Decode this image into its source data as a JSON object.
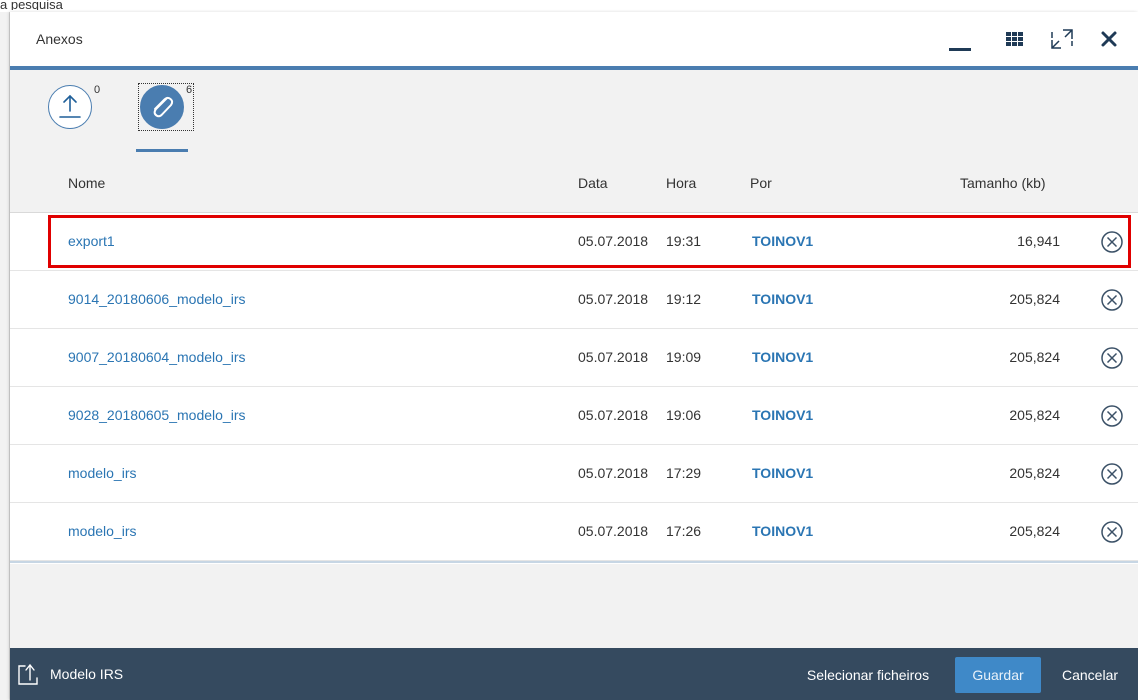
{
  "background_text": "a pesquisa",
  "dialog": {
    "title": "Anexos",
    "header_buttons": {
      "minimize_icon": "minimize-icon",
      "grid_icon": "grid-icon",
      "fullscreen_icon": "fullscreen-icon",
      "close_icon": "close-icon"
    }
  },
  "iconbar": {
    "tabs": [
      {
        "name": "upload",
        "icon": "upload-icon",
        "count": "0"
      },
      {
        "name": "attachments",
        "icon": "paperclip-icon",
        "count": "6",
        "selected": true
      }
    ]
  },
  "table": {
    "headers": {
      "name": "Nome",
      "date": "Data",
      "time": "Hora",
      "by": "Por",
      "size": "Tamanho (kb)"
    },
    "rows": [
      {
        "name": "export1",
        "date": "05.07.2018",
        "time": "19:31",
        "by": "TOINOV1",
        "size": "16,941",
        "highlighted": true
      },
      {
        "name": "9014_20180606_modelo_irs",
        "date": "05.07.2018",
        "time": "19:12",
        "by": "TOINOV1",
        "size": "205,824"
      },
      {
        "name": "9007_20180604_modelo_irs",
        "date": "05.07.2018",
        "time": "19:09",
        "by": "TOINOV1",
        "size": "205,824"
      },
      {
        "name": "9028_20180605_modelo_irs",
        "date": "05.07.2018",
        "time": "19:06",
        "by": "TOINOV1",
        "size": "205,824"
      },
      {
        "name": "modelo_irs",
        "date": "05.07.2018",
        "time": "17:29",
        "by": "TOINOV1",
        "size": "205,824"
      },
      {
        "name": "modelo_irs",
        "date": "05.07.2018",
        "time": "17:26",
        "by": "TOINOV1",
        "size": "205,824"
      }
    ]
  },
  "footer": {
    "left_label": "Modelo IRS",
    "left_icon": "export-icon",
    "select_files": "Selecionar ficheiros",
    "save": "Guardar",
    "cancel": "Cancelar"
  },
  "colors": {
    "accent": "#4a7db0",
    "link": "#2a75b3",
    "footer_bg": "#354a5f",
    "primary_button": "#3f89c8",
    "highlight": "#e00000"
  }
}
